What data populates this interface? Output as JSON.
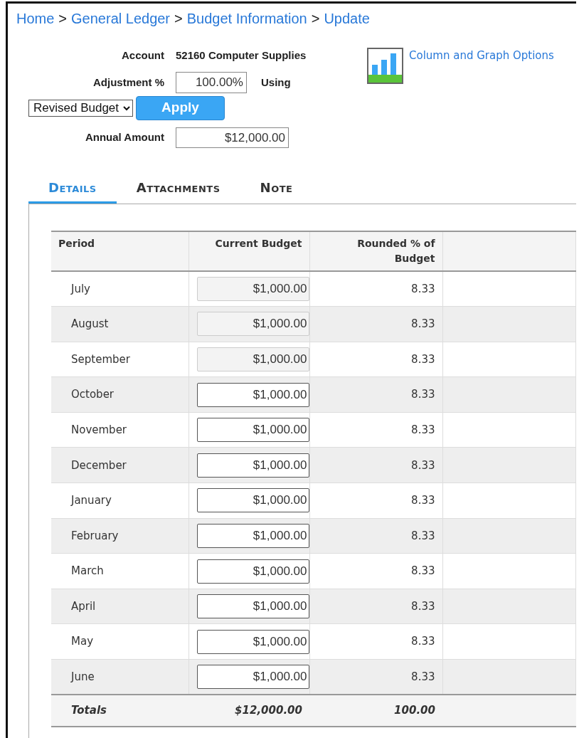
{
  "breadcrumb": [
    {
      "label": "Home"
    },
    {
      "label": "General Ledger"
    },
    {
      "label": "Budget Information"
    },
    {
      "label": "Update"
    }
  ],
  "breadcrumb_separator": ">",
  "form": {
    "account_label": "Account",
    "account_value": "52160 Computer Supplies",
    "adjustment_label": "Adjustment %",
    "adjustment_value": "100.00%",
    "using_label": "Using",
    "using_select": "Revised Budget",
    "apply_button": "Apply",
    "annual_label": "Annual Amount",
    "annual_value": "$12,000.00"
  },
  "options_link": "Column and Graph Options",
  "tabs": [
    {
      "label": "Details",
      "selected": true
    },
    {
      "label": "Attachments",
      "selected": false
    },
    {
      "label": "Note",
      "selected": false
    }
  ],
  "table": {
    "columns": [
      "Period",
      "Current Budget",
      "Rounded % of Budget"
    ],
    "rows": [
      {
        "period": "July",
        "budget": "$1,000.00",
        "percent": "8.33",
        "disabled": true
      },
      {
        "period": "August",
        "budget": "$1,000.00",
        "percent": "8.33",
        "disabled": true
      },
      {
        "period": "September",
        "budget": "$1,000.00",
        "percent": "8.33",
        "disabled": true
      },
      {
        "period": "October",
        "budget": "$1,000.00",
        "percent": "8.33",
        "disabled": false
      },
      {
        "period": "November",
        "budget": "$1,000.00",
        "percent": "8.33",
        "disabled": false
      },
      {
        "period": "December",
        "budget": "$1,000.00",
        "percent": "8.33",
        "disabled": false
      },
      {
        "period": "January",
        "budget": "$1,000.00",
        "percent": "8.33",
        "disabled": false
      },
      {
        "period": "February",
        "budget": "$1,000.00",
        "percent": "8.33",
        "disabled": false
      },
      {
        "period": "March",
        "budget": "$1,000.00",
        "percent": "8.33",
        "disabled": false
      },
      {
        "period": "April",
        "budget": "$1,000.00",
        "percent": "8.33",
        "disabled": false
      },
      {
        "period": "May",
        "budget": "$1,000.00",
        "percent": "8.33",
        "disabled": false
      },
      {
        "period": "June",
        "budget": "$1,000.00",
        "percent": "8.33",
        "disabled": false
      }
    ],
    "totals": {
      "label": "Totals",
      "budget": "$12,000.00",
      "percent": "100.00"
    }
  }
}
